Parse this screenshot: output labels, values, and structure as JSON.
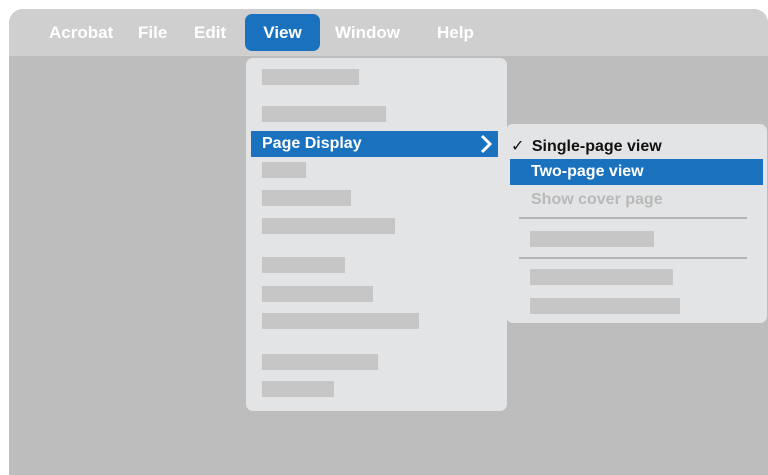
{
  "menubar": {
    "items": [
      "Acrobat",
      "File",
      "Edit",
      "View",
      "Window",
      "Help"
    ],
    "active": "View"
  },
  "view_menu": {
    "highlighted_item": "Page Display",
    "submenu_indicator": "chevron-right-icon"
  },
  "page_display_submenu": {
    "checked_marker": "✓",
    "items": [
      {
        "label": "Single-page view",
        "checked": true,
        "state": "normal"
      },
      {
        "label": "Two-page view",
        "checked": false,
        "state": "highlighted"
      },
      {
        "label": "Show cover page",
        "checked": false,
        "state": "disabled"
      }
    ]
  },
  "colors": {
    "accent": "#1a72bf",
    "window_background": "#bdbdbd",
    "menubar_background": "#cfcfd0",
    "menu_background": "#e3e4e5",
    "placeholder": "#c6c6c6",
    "disabled_text": "#b9b9b9",
    "normal_text": "#111111"
  }
}
